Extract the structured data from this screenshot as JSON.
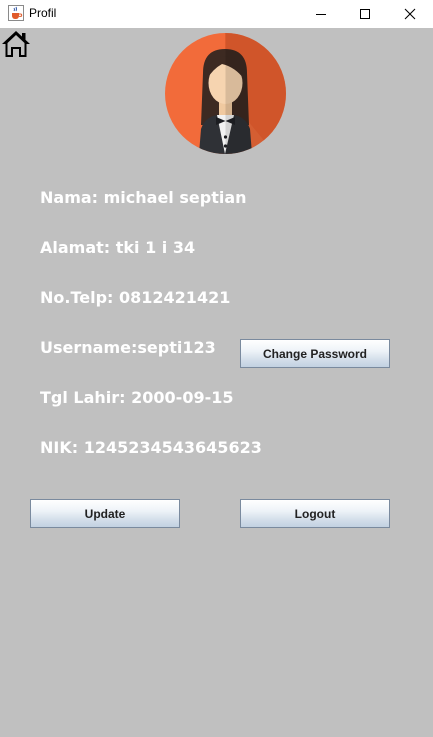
{
  "window": {
    "title": "Profil",
    "app_icon": "java-cup-icon",
    "controls": [
      "minimize-icon",
      "maximize-icon",
      "close-icon"
    ]
  },
  "nav": {
    "home_icon": "home-icon"
  },
  "avatar": {
    "icon": "waiter-avatar-icon",
    "bg_color": "#f26b3a"
  },
  "profile": {
    "nama": "Nama: michael septian",
    "alamat": "Alamat: tki 1 i 34",
    "telp": "No.Telp: 0812421421",
    "username": "Username:septi123",
    "tgl_lahir": "Tgl Lahir: 2000-09-15",
    "nik": "NIK: 1245234543645623"
  },
  "buttons": {
    "change_password": "Change Password",
    "update": "Update",
    "logout": "Logout"
  },
  "colors": {
    "background": "#c0c0c0",
    "text": "#ffffff"
  }
}
